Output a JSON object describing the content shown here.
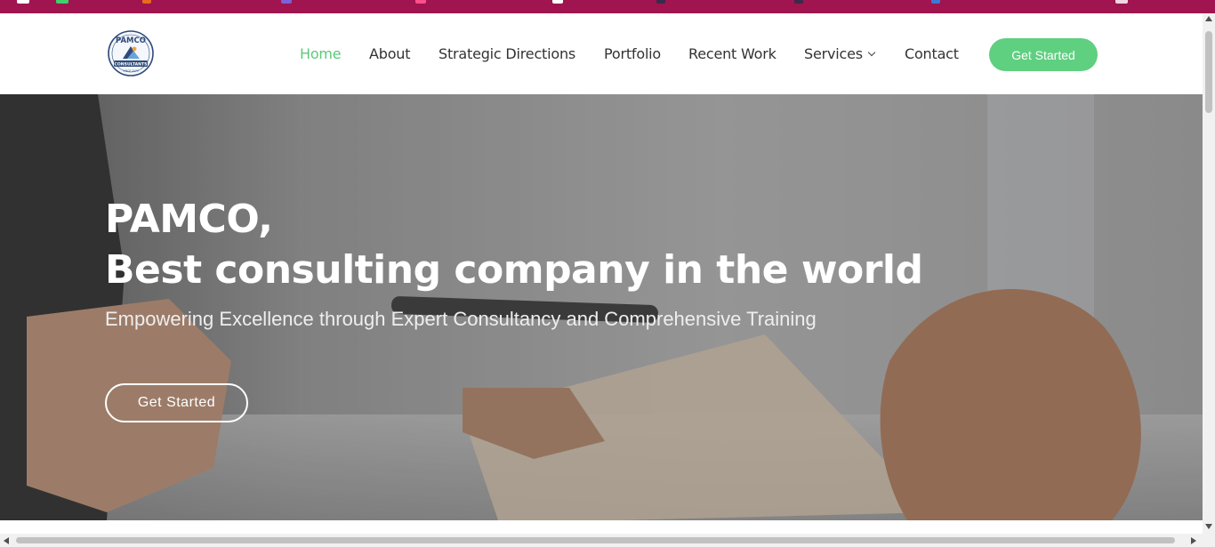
{
  "brand": {
    "logo_top_text": "PAMCO",
    "logo_ribbon_text": "CONSULTANTS",
    "logo_since_text": "SINCE 2009"
  },
  "nav": {
    "items": [
      {
        "label": "Home",
        "active": true
      },
      {
        "label": "About"
      },
      {
        "label": "Strategic Directions"
      },
      {
        "label": "Portfolio"
      },
      {
        "label": "Recent Work"
      },
      {
        "label": "Services",
        "has_dropdown": true
      },
      {
        "label": "Contact"
      }
    ],
    "cta_label": "Get Started"
  },
  "hero": {
    "title_line1": "PAMCO,",
    "title_line2": "Best consulting company in the world",
    "subtitle": "Empowering Excellence through Expert Consultancy and Comprehensive Training",
    "cta_label": "Get Started"
  },
  "colors": {
    "topbar": "#a0144f",
    "accent_green": "#5fcf80",
    "active_nav": "#5cc97a"
  },
  "icons": [
    "whatsapp-icon",
    "chevron-down-icon"
  ]
}
